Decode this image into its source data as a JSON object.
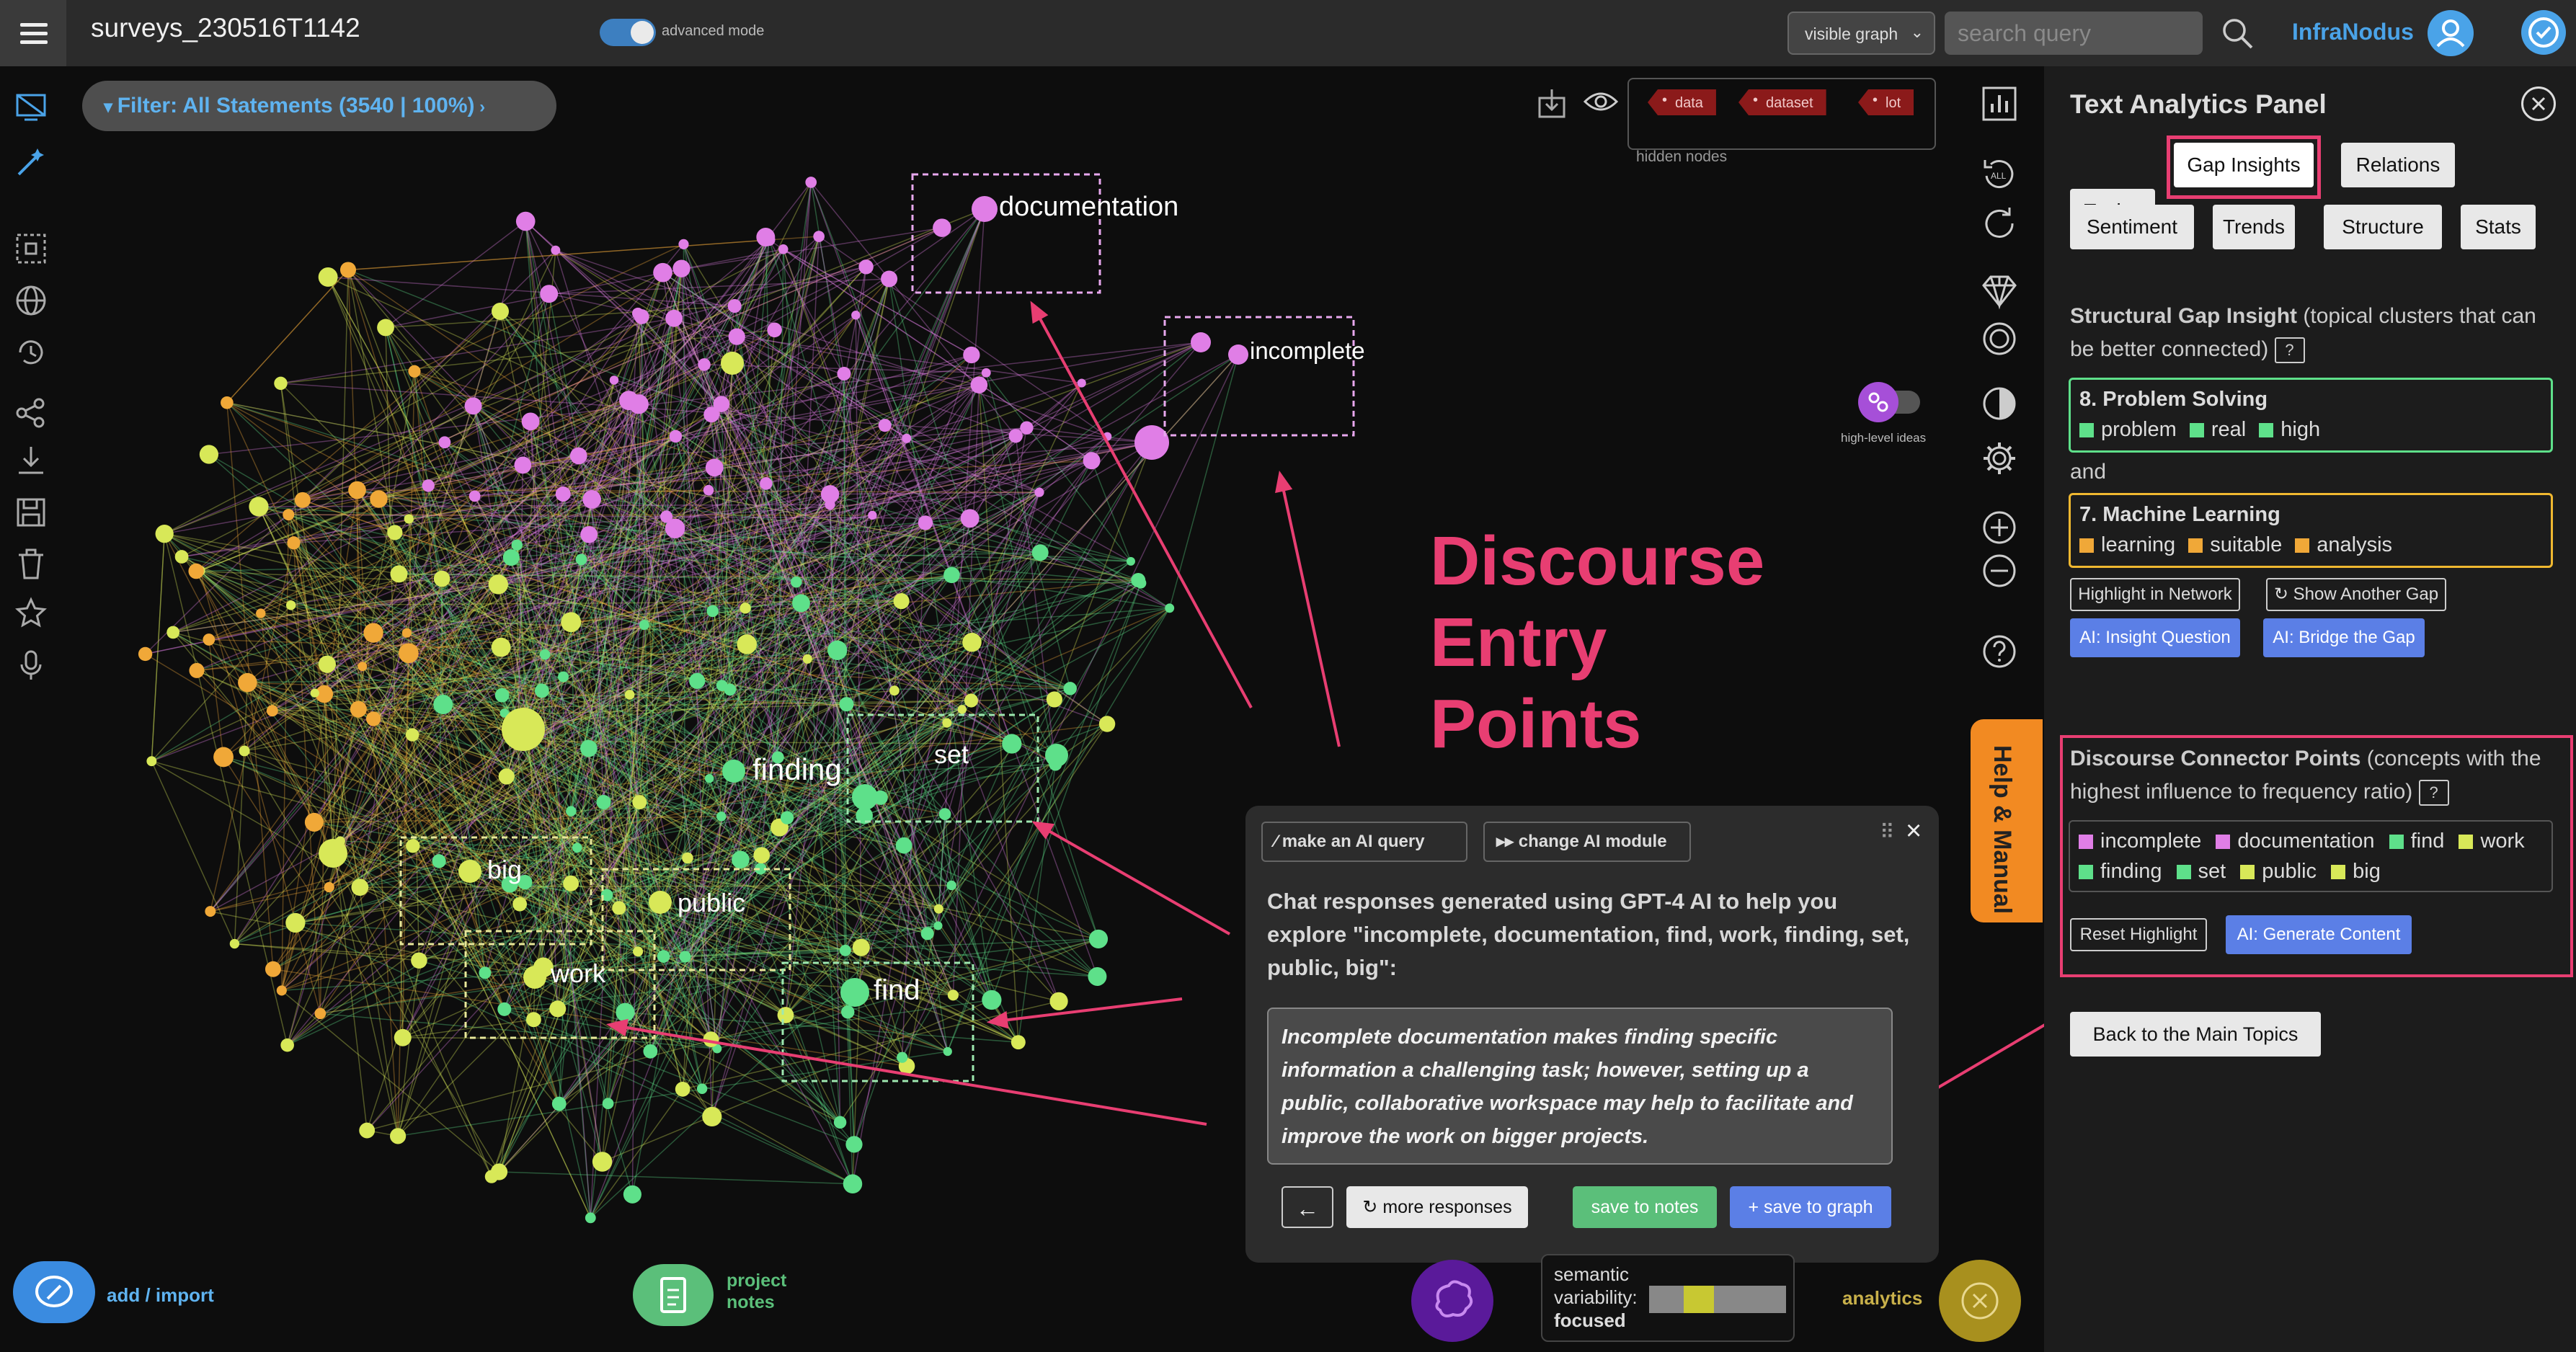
{
  "header": {
    "title": "surveys_230516T1142",
    "advanced_mode_label": "advanced mode",
    "visible_select": "visible graph",
    "search_placeholder": "search query",
    "brand": "InfraNodus"
  },
  "filter": {
    "label": "Filter: All Statements (3540 | 100%)"
  },
  "hidden_nodes": {
    "tags": [
      "data",
      "dataset",
      "lot"
    ],
    "label": "hidden nodes"
  },
  "high_level_ideas_label": "high-level ideas",
  "annotation_title": [
    "Discourse",
    "Entry",
    "Points"
  ],
  "graph_labels": {
    "documentation": "documentation",
    "incomplete": "incomplete",
    "finding": "finding",
    "set": "set",
    "big": "big",
    "public": "public",
    "work": "work",
    "find": "find"
  },
  "help_tab": "Help & Manual",
  "chat": {
    "make_query": "make an AI query",
    "change_module": "change AI module",
    "intro": "Chat responses generated using GPT-4 AI to help you explore \"incomplete, documentation, find, work, finding, set, public, big\":",
    "response": "Incomplete documentation makes finding specific information a challenging task; however, setting up a public, collaborative workspace may help to facilitate and improve the work on bigger projects.",
    "back": "←",
    "more": "↻ more responses",
    "save_notes": "save to notes",
    "save_graph": "+ save to graph"
  },
  "panel": {
    "title": "Text Analytics Panel",
    "tabs_row1": [
      "Topics",
      "Gap Insights",
      "Relations"
    ],
    "tabs_row2": [
      "Sentiment",
      "Trends",
      "Structure",
      "Stats"
    ],
    "gap_heading": "Structural Gap Insight",
    "gap_sub": " (topical clusters that can be better connected)",
    "gap_a_title": "8. Problem Solving",
    "gap_a_words": [
      "problem",
      "real",
      "high"
    ],
    "and": "and",
    "gap_b_title": "7. Machine Learning",
    "gap_b_words": [
      "learning",
      "suitable",
      "analysis"
    ],
    "highlight_btn": "Highlight in Network",
    "another_gap_btn": "↻ Show Another Gap",
    "insight_q_btn": "AI: Insight Question",
    "bridge_btn": "AI: Bridge the Gap",
    "connector_heading": "Discourse Connector Points",
    "connector_sub": " (concepts with the highest influence to frequency ratio)",
    "connector_words_row1": [
      "incomplete",
      "documentation",
      "find",
      "work"
    ],
    "connector_words_row2": [
      "finding",
      "set",
      "public",
      "big"
    ],
    "reset_btn": "Reset Highlight",
    "generate_btn": "AI: Generate Content",
    "back_main_btn": "Back to the Main Topics"
  },
  "bottom": {
    "add_import": "add / import",
    "project_notes": [
      "project",
      "notes"
    ],
    "semantic": [
      "semantic",
      "variability:",
      "focused"
    ],
    "analytics": "analytics"
  },
  "colors": {
    "accent_pink": "#e83e72",
    "brand_blue": "#4aa3e8",
    "pink_node": "#e07ee6",
    "green_node": "#5ee08a",
    "yellow_node": "#d8e858",
    "orange_node": "#f0a838"
  }
}
